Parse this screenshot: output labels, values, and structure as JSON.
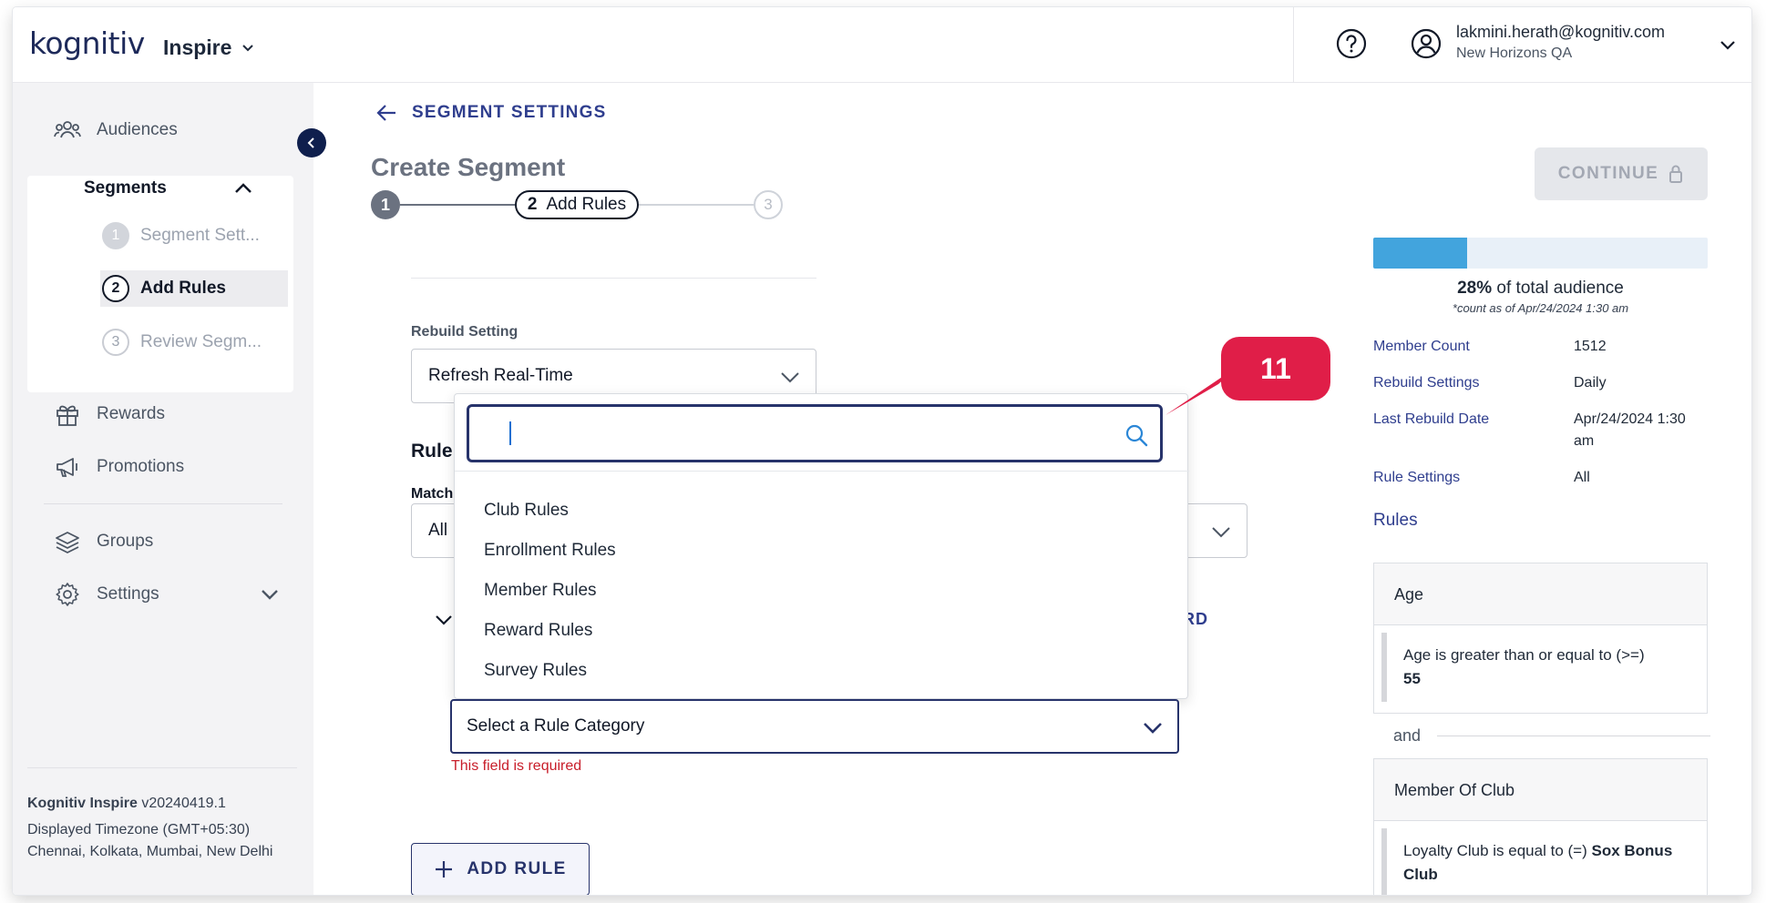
{
  "header": {
    "logo_main": "kognitiv",
    "product": "Inspire",
    "user_email": "lakmini.herath@kognitiv.com",
    "user_org": "New Horizons QA"
  },
  "sidebar": {
    "items": [
      {
        "label": "Audiences",
        "icon": "audiences-icon"
      },
      {
        "label": "Rewards",
        "icon": "gift-icon"
      },
      {
        "label": "Promotions",
        "icon": "megaphone-icon"
      },
      {
        "label": "Groups",
        "icon": "layers-icon"
      },
      {
        "label": "Settings",
        "icon": "gear-icon"
      }
    ],
    "segments_label": "Segments",
    "steps": [
      {
        "num": "1",
        "label": "Segment Sett..."
      },
      {
        "num": "2",
        "label": "Add Rules"
      },
      {
        "num": "3",
        "label": "Review Segm..."
      }
    ],
    "footer": {
      "app_name": "Kognitiv Inspire",
      "version": "v20240419.1",
      "timezone_line1": "Displayed Timezone (GMT+05:30)",
      "timezone_line2": "Chennai, Kolkata, Mumbai, New Delhi"
    }
  },
  "main": {
    "back_label": "SEGMENT SETTINGS",
    "title": "Create Segment",
    "stepper": {
      "step1": "1",
      "step2_num": "2",
      "step2_label": "Add Rules",
      "step3": "3"
    },
    "rebuild_label": "Rebuild Setting",
    "rebuild_value": "Refresh Real-Time",
    "rules_partial": "Rule",
    "match_partial": "Match",
    "match_value_partial": "All",
    "card_action_partial": "RD",
    "dropdown": {
      "search_value": "",
      "options": [
        "Club Rules",
        "Enrollment Rules",
        "Member Rules",
        "Reward Rules",
        "Survey Rules"
      ]
    },
    "rule_category_placeholder": "Select a Rule Category",
    "error_text": "This field is required",
    "add_rule_label": "ADD RULE",
    "callout_number": "11"
  },
  "summary": {
    "continue_label": "CONTINUE",
    "audience_fraction": 0.28,
    "audience_pct": "28%",
    "audience_text": "of total audience",
    "count_note": "*count as of Apr/24/2024 1:30 am",
    "fields": [
      {
        "key": "Member Count",
        "value": "1512"
      },
      {
        "key": "Rebuild Settings",
        "value": "Daily"
      },
      {
        "key": "Last Rebuild Date",
        "value": "Apr/24/2024 1:30 am"
      },
      {
        "key": "Rule Settings",
        "value": "All"
      }
    ],
    "rules_heading": "Rules",
    "rule_cards": [
      {
        "title": "Age",
        "body_text": "Age is greater than or equal to (>=)",
        "body_bold": "55"
      },
      {
        "title": "Member Of Club",
        "body_text": "Loyalty Club is equal to (=)",
        "body_bold": "Sox Bonus Club"
      }
    ],
    "join_word": "and"
  },
  "colors": {
    "brand_navy": "#27336b",
    "brand_teal": "#1aa3a8",
    "callout_red": "#e01e48",
    "progress_blue": "#42a4dd",
    "error_red": "#c81e2a"
  }
}
